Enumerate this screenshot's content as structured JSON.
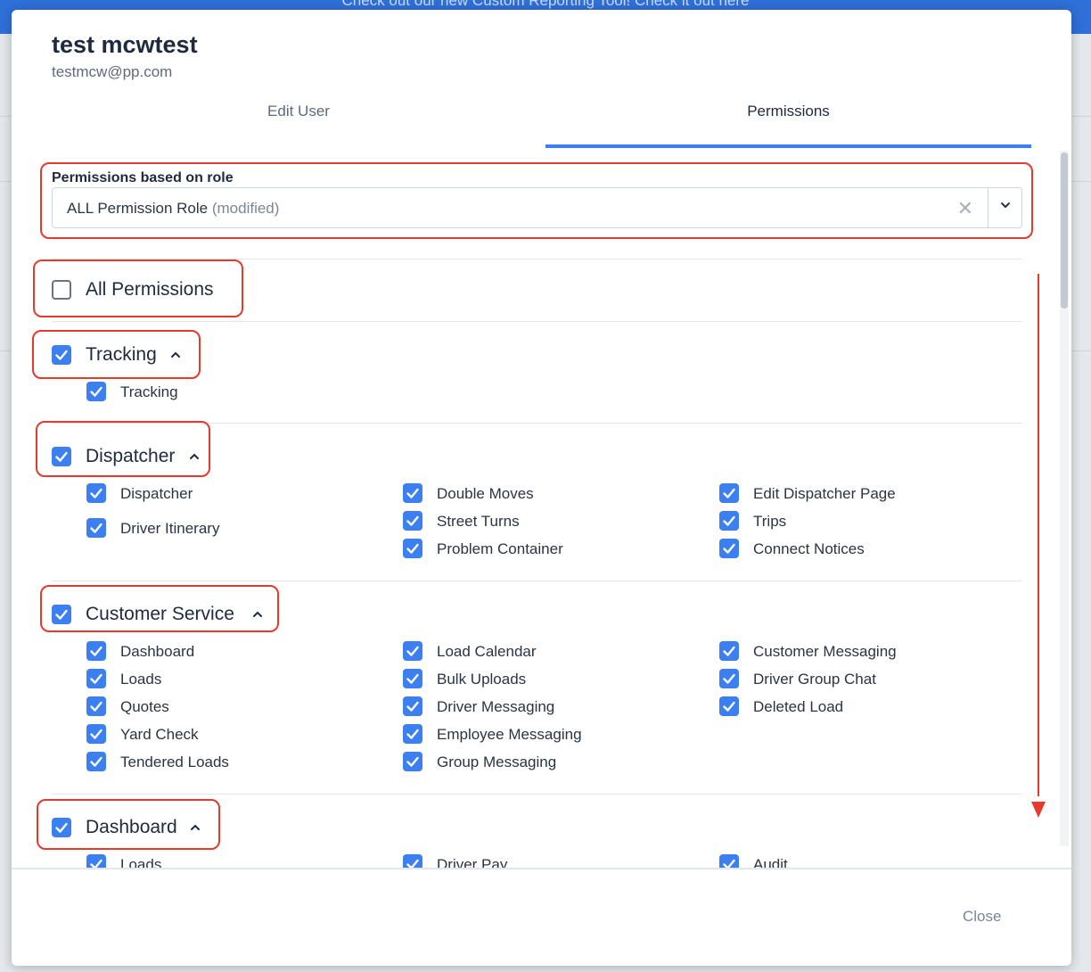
{
  "background": {
    "banner_text": "Check out our new Custom Reporting Tool!  Check it out here"
  },
  "user": {
    "name": "test mcwtest",
    "email": "testmcw@pp.com"
  },
  "tabs": [
    {
      "label": "Edit User",
      "active": false
    },
    {
      "label": "Permissions",
      "active": true
    }
  ],
  "role": {
    "label": "Permissions based on role",
    "value": "ALL Permission Role",
    "modifier": "(modified)"
  },
  "all_permissions": {
    "label": "All Permissions",
    "checked": false
  },
  "groups": [
    {
      "label": "Tracking",
      "checked": true,
      "items": [
        {
          "label": "Tracking",
          "checked": true
        }
      ]
    },
    {
      "label": "Dispatcher",
      "checked": true,
      "items": [
        {
          "label": "Dispatcher",
          "checked": true
        },
        {
          "label": "Driver Itinerary",
          "checked": true
        },
        {
          "label": "Double Moves",
          "checked": true
        },
        {
          "label": "Street Turns",
          "checked": true
        },
        {
          "label": "Problem Container",
          "checked": true
        },
        {
          "label": "Edit Dispatcher Page",
          "checked": true
        },
        {
          "label": "Trips",
          "checked": true
        },
        {
          "label": "Connect Notices",
          "checked": true
        }
      ]
    },
    {
      "label": "Customer Service",
      "checked": true,
      "items": [
        {
          "label": "Dashboard",
          "checked": true
        },
        {
          "label": "Loads",
          "checked": true
        },
        {
          "label": "Quotes",
          "checked": true
        },
        {
          "label": "Yard Check",
          "checked": true
        },
        {
          "label": "Tendered Loads",
          "checked": true
        },
        {
          "label": "Load Calendar",
          "checked": true
        },
        {
          "label": "Bulk Uploads",
          "checked": true
        },
        {
          "label": "Driver Messaging",
          "checked": true
        },
        {
          "label": "Employee Messaging",
          "checked": true
        },
        {
          "label": "Group Messaging",
          "checked": true
        },
        {
          "label": "Customer Messaging",
          "checked": true
        },
        {
          "label": "Driver Group Chat",
          "checked": true
        },
        {
          "label": "Deleted Load",
          "checked": true
        }
      ]
    },
    {
      "label": "Dashboard",
      "checked": true,
      "items": [
        {
          "label": "Loads",
          "checked": true
        },
        {
          "label": "Driver Pay",
          "checked": true
        },
        {
          "label": "Audit",
          "checked": true
        }
      ]
    }
  ],
  "footer": {
    "close_label": "Close"
  },
  "icons": {
    "check": "check-icon",
    "chevron_up": "chevron-up-icon",
    "chevron_down": "chevron-down-icon",
    "clear": "clear-icon"
  },
  "colors": {
    "accent": "#3b7ff0",
    "annotation": "#e53a2c"
  }
}
